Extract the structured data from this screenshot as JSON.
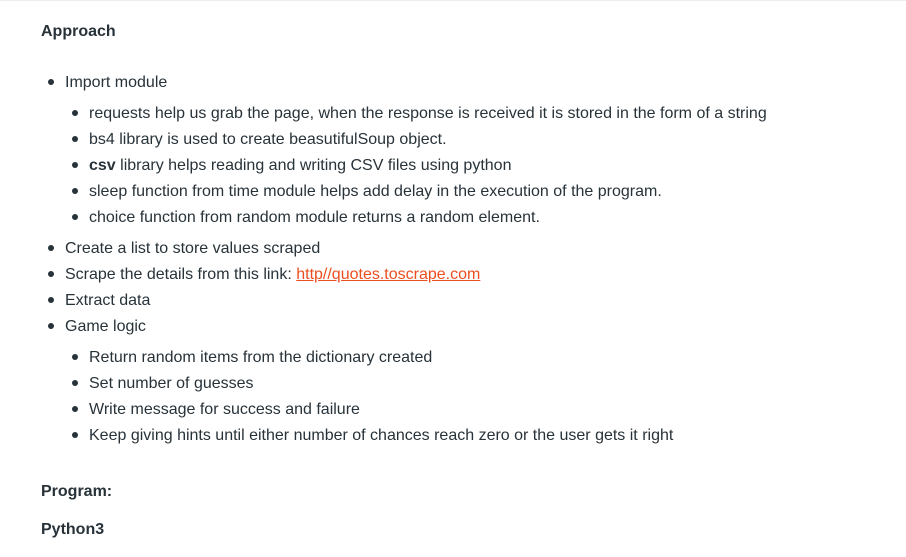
{
  "heading_approach": "Approach",
  "items": [
    {
      "label": "Import module"
    },
    {
      "label": "requests help us grab the page, when the response is received it is stored in the form of a string"
    },
    {
      "label": "bs4 library is used to create beasutifulSoup object."
    },
    {
      "bold": "csv",
      "label": " library helps reading and writing CSV files using python"
    },
    {
      "label": "sleep function from time module helps add delay in the execution of the program."
    },
    {
      "label": "choice function from random module returns a random element."
    },
    {
      "label": "Create a list to store values scraped"
    },
    {
      "label": "Scrape the details from this link: ",
      "link": "http//quotes.toscrape.com"
    },
    {
      "label": "Extract data"
    },
    {
      "label": "Game logic"
    },
    {
      "label": "Return random items from the dictionary created"
    },
    {
      "label": "Set number of guesses"
    },
    {
      "label": "Write message for success and failure"
    },
    {
      "label": "Keep giving hints until either number of chances reach zero or the user gets it right"
    }
  ],
  "heading_program": "Program:",
  "heading_language": "Python3",
  "colors": {
    "text": "#273239",
    "link": "#ec4e20"
  }
}
